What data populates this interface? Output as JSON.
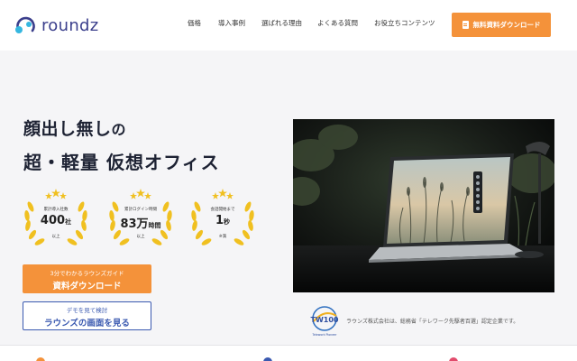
{
  "header": {
    "logo_text": "roundz",
    "nav": [
      "価格",
      "導入事例",
      "選ばれる理由",
      "よくある質問",
      "お役立ちコンテンツ"
    ],
    "cta_label": "無料資料ダウンロード"
  },
  "hero": {
    "headline_line1_main": "顔出し無し",
    "headline_line1_suffix": "の",
    "headline_line2": "超・軽量 仮想オフィス",
    "badges": [
      {
        "label": "累計導入社数",
        "value": "400",
        "unit": "社",
        "note": "以上"
      },
      {
        "label": "累計ログイン時間",
        "value": "83万",
        "unit": "時間",
        "note": "以上"
      },
      {
        "label": "会話開始まで",
        "value": "1",
        "unit": "秒",
        "note": "※満"
      }
    ],
    "download_button": {
      "sub": "3分でわかるラウンズガイド",
      "main": "資料ダウンロード"
    },
    "demo_button": {
      "sub": "デモを見て検討",
      "main": "ラウンズの画面を見る"
    },
    "certification_text": "ラウンズ株式会社は、総務省「テレワーク先駆者百選」認定企業です。",
    "certification_logo_text": "TW100"
  },
  "colors": {
    "accent_orange": "#f4923a",
    "brand_blue": "#3a59b0",
    "logo_purple": "#3b3f8c",
    "gold": "#f0c020"
  }
}
